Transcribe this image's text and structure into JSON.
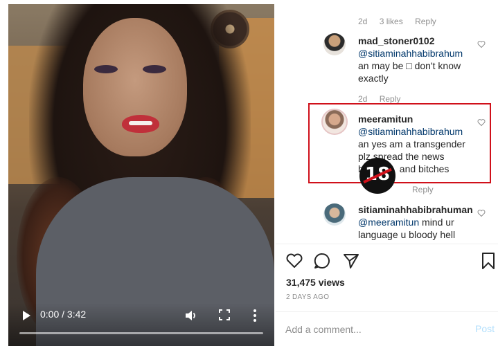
{
  "video": {
    "time": "0:00 / 3:42",
    "icons": [
      "play-icon",
      "volume-icon",
      "fullscreen-icon",
      "more-icon"
    ],
    "progress": 0
  },
  "comments_meta_top": {
    "age": "2d",
    "likes": "3 likes",
    "reply": "Reply"
  },
  "comments": [
    {
      "username": "mad_stoner0102",
      "mention": "@sitiaminahhabibrahum",
      "text": "an may be □ don't know exactly",
      "age": "2d",
      "reply": "Reply"
    },
    {
      "username": "meeramitun",
      "mention": "@sitiaminahhabibrahum",
      "text_line1": "an yes am a transgender",
      "text_line2": "plz spread the news",
      "text_line3_a": "b",
      "text_line3_b": "and bitches",
      "reply": "Reply"
    },
    {
      "username": "sitiaminahhabibrahuman",
      "mention": "@meeramitun",
      "text": " mind ur language u bloody hell"
    }
  ],
  "badge": {
    "text": "18"
  },
  "actions": {
    "icons": [
      "heart-icon",
      "comment-icon",
      "share-icon",
      "bookmark-icon"
    ]
  },
  "views": "31,475 views",
  "posted": "2 DAYS AGO",
  "add_comment": {
    "placeholder": "Add a comment...",
    "post_label": "Post"
  },
  "colors": {
    "highlight": "#d0101a",
    "mention": "#00376b",
    "muted": "#8e8e8e",
    "post_disabled": "#b2dffc"
  }
}
